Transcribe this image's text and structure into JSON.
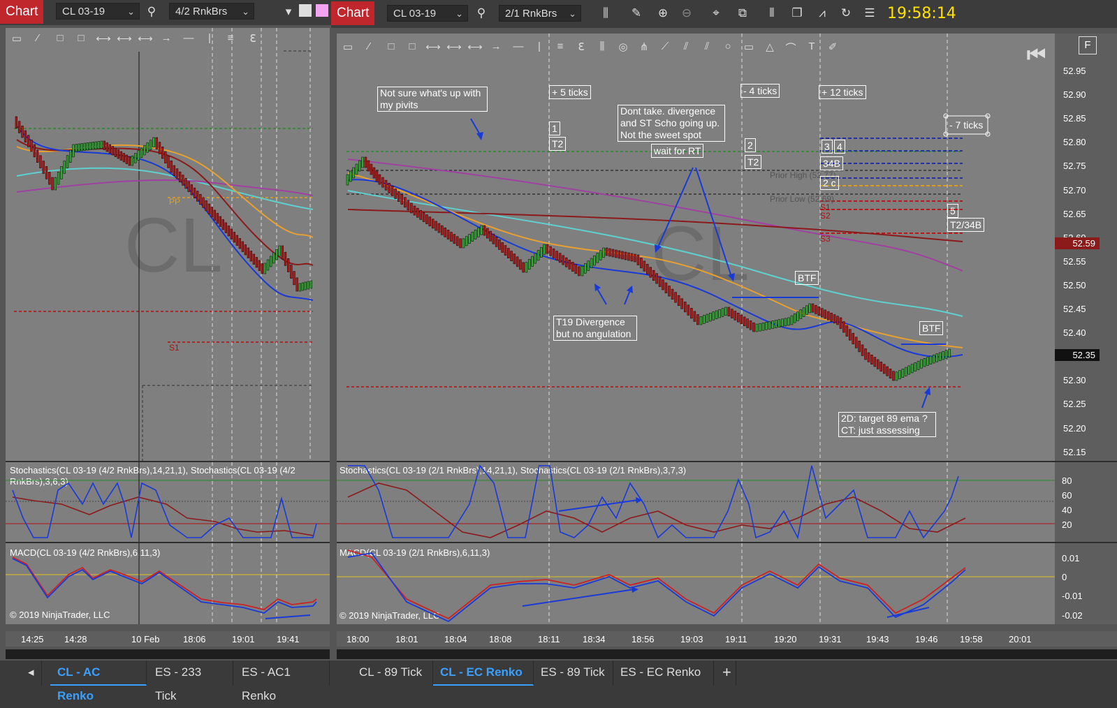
{
  "left_window": {
    "chart_label": "Chart",
    "instrument": "CL 03-19",
    "bar_type": "4/2 RnkBrs",
    "watermark": "CL",
    "level_labels": {
      "pp": "PP",
      "s1": "S1"
    },
    "stoch_label": "Stochastics(CL 03-19 (4/2 RnkBrs),14,21,1), Stochastics(CL 03-19 (4/2 RnkBrs),3,6,3)",
    "macd_label": "MACD(CL 03-19 (4/2 RnkBrs),6,11,3)",
    "copyright": "© 2019 NinjaTrader, LLC",
    "time_labels": [
      "14:25",
      "14:28",
      "10 Feb",
      "18:06",
      "19:01",
      "19:41"
    ]
  },
  "right_window": {
    "chart_label": "Chart",
    "instrument": "CL 03-19",
    "bar_type": "2/1 RnkBrs",
    "clock": "19:58:14",
    "watermark": "CL",
    "stoch_label": "Stochastics(CL 03-19 (2/1 RnkBrs),14,21,1), Stochastics(CL 03-19 (2/1 RnkBrs),3,7,3)",
    "macd_label": "MACD(CL 03-19 (2/1 RnkBrs),6,11,3)",
    "copyright": "© 2019 NinjaTrader, LLC",
    "f_button": "F",
    "price_labels": [
      "52.95",
      "52.90",
      "52.85",
      "52.80",
      "52.75",
      "52.70",
      "52.65",
      "52.60",
      "52.55",
      "52.50",
      "52.45",
      "52.40",
      "52.35",
      "52.30",
      "52.25",
      "52.20",
      "52.15"
    ],
    "current_price_tag": "52.59",
    "last_price_tag": "52.35",
    "stoch_axis": [
      "80",
      "60",
      "40",
      "20"
    ],
    "macd_axis": [
      "0.01",
      "0",
      "-0.01",
      "-0.02"
    ],
    "time_labels": [
      "18:00",
      "18:01",
      "18:04",
      "18:08",
      "18:11",
      "18:34",
      "18:56",
      "19:03",
      "19:11",
      "19:20",
      "19:31",
      "19:43",
      "19:46",
      "19:58",
      "20:01"
    ],
    "annotations": {
      "pivots": "Not sure what's up with my pivits",
      "plus5": "+ 5 ticks",
      "t1": "1",
      "t2a": "T2",
      "dont_take": "Dont take. divergence and ST Scho going up. Not the sweet spot",
      "wait_rt": "wait for RT",
      "minus4": "- 4 ticks",
      "t2": "2",
      "t2b": "T2",
      "plus12": "+ 12 ticks",
      "three": "3",
      "four": "4",
      "b34": "34B",
      "two_c": "2 c",
      "minus7": "- 7 ticks",
      "five": "5",
      "t2_34b": "T2/34B",
      "btf1": "BTF",
      "btf2": "BTF",
      "t19": "T19 Divergence but no angulation",
      "target": "2D: target 89 ema ? CT: just assessing",
      "prior_high": "Prior High (52.77)",
      "prior_low": "Prior Low (52.69)",
      "s1": "S1",
      "s2": "S2",
      "s3": "S3"
    }
  },
  "tabs_left": [
    {
      "label": "CL - AC Renko",
      "active": true
    },
    {
      "label": "ES - 233 Tick",
      "active": false
    },
    {
      "label": "ES - AC1 Renko",
      "active": false
    }
  ],
  "tabs_right": [
    {
      "label": "CL - 89 Tick",
      "active": false
    },
    {
      "label": "CL - EC Renko",
      "active": true
    },
    {
      "label": "ES - 89 Tick",
      "active": false
    },
    {
      "label": "ES - EC Renko",
      "active": false
    },
    {
      "label": "+",
      "active": false
    }
  ],
  "colors": {
    "chart_red": "#c0272d",
    "clock_yellow": "#ffe000",
    "tab_active": "#3aa0ff"
  }
}
